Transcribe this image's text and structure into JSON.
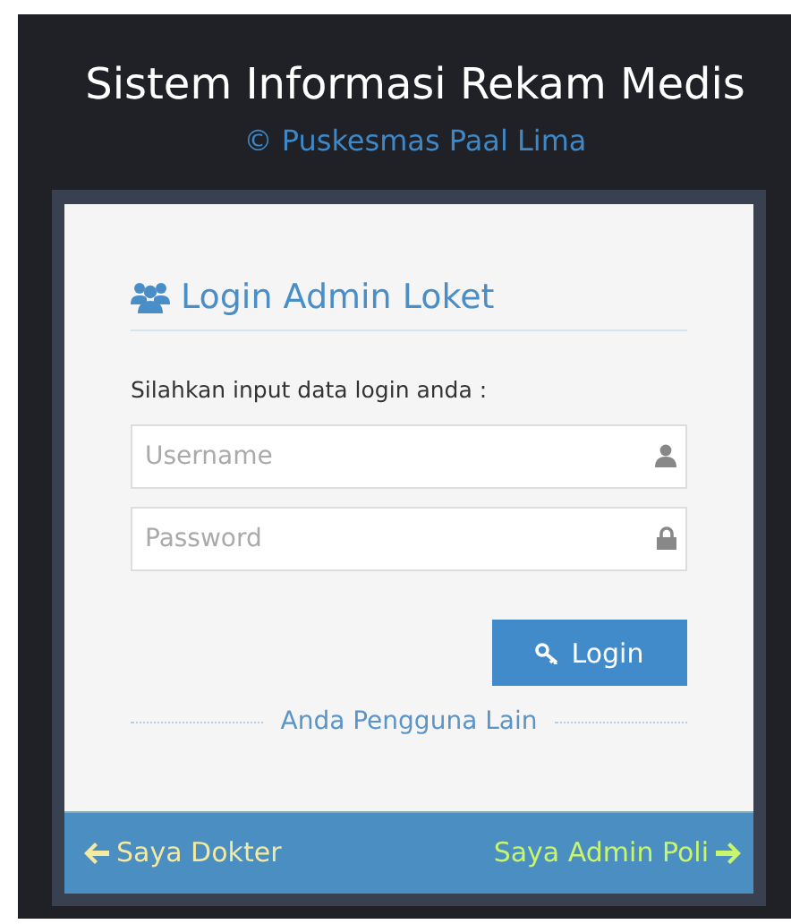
{
  "header": {
    "title": "Sistem Informasi Rekam Medis",
    "subtitle": "© Puskesmas Paal Lima"
  },
  "login": {
    "heading": "Login Admin Loket",
    "instruction": "Silahkan input data login anda :",
    "fields": [
      {
        "kind": "username",
        "placeholder": "Username"
      },
      {
        "kind": "password",
        "placeholder": "Password"
      }
    ],
    "button": "Login",
    "divider": "Anda Pengguna Lain"
  },
  "footer": {
    "left": "Saya Dokter",
    "right": "Saya Admin Poli"
  }
}
